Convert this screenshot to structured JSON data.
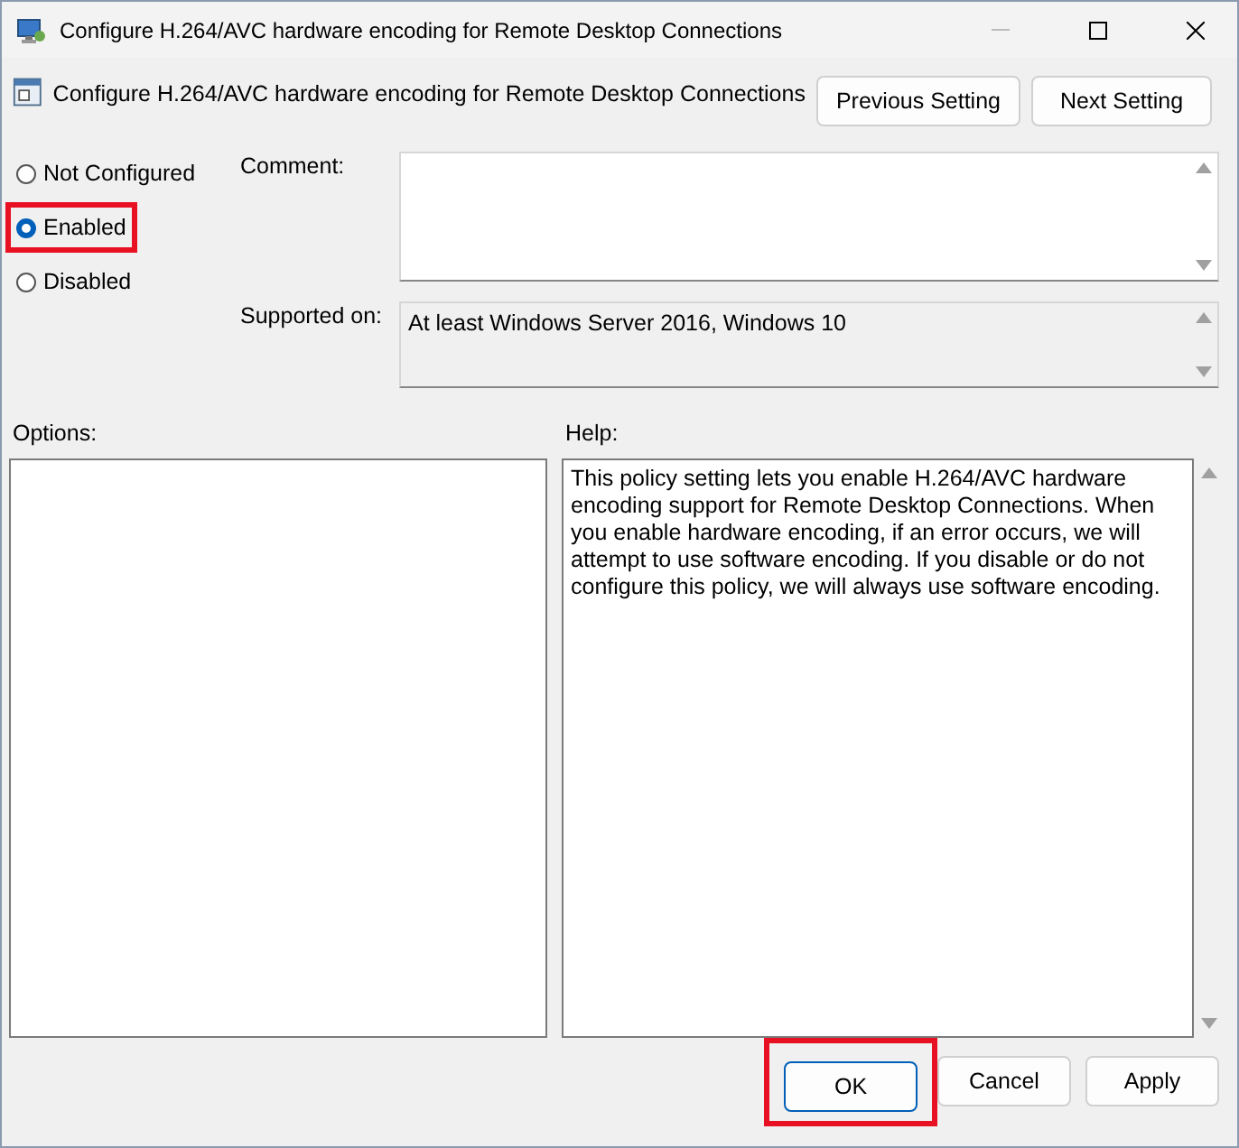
{
  "window": {
    "title": "Configure H.264/AVC hardware encoding for Remote Desktop Connections"
  },
  "header": {
    "title": "Configure H.264/AVC hardware encoding for Remote Desktop Connections",
    "buttons": [
      {
        "label": "Previous Setting"
      },
      {
        "label": "Next Setting"
      }
    ]
  },
  "state_options": [
    {
      "label": "Not Configured",
      "selected": false,
      "highlighted": false
    },
    {
      "label": "Enabled",
      "selected": true,
      "highlighted": true
    },
    {
      "label": "Disabled",
      "selected": false,
      "highlighted": false
    }
  ],
  "comment": {
    "label": "Comment:"
  },
  "supported_on": {
    "label": "Supported on:",
    "value": "At least Windows Server 2016, Windows 10"
  },
  "options": {
    "label": "Options:"
  },
  "help": {
    "label": "Help:",
    "text": "This policy setting lets you enable H.264/AVC hardware encoding support for Remote Desktop Connections. When you enable hardware encoding, if an error occurs, we will attempt to use software encoding. If you disable or do not configure this policy, we will always use software encoding."
  },
  "buttons": [
    {
      "label": "OK",
      "default": true,
      "highlighted": true
    },
    {
      "label": "Cancel",
      "default": false,
      "highlighted": false
    },
    {
      "label": "Apply",
      "default": false,
      "highlighted": false
    }
  ]
}
